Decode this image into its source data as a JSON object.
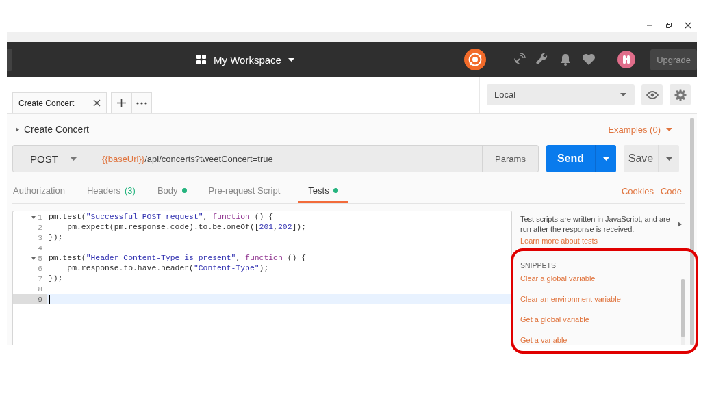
{
  "header": {
    "workspace": "My Workspace",
    "upgrade_button": "Upgrade"
  },
  "tabs": [
    {
      "label": "Create Concert",
      "selected": true
    }
  ],
  "environment": {
    "value": "Local"
  },
  "request": {
    "name": "Create Concert",
    "expanded": false,
    "examples": "Examples (0)",
    "method": "POST",
    "url": {
      "variable": "{{baseUrl}}",
      "path": "/api/concerts?tweetConcert=true"
    },
    "params_button": "Params",
    "send_button": "Send",
    "save_button": "Save"
  },
  "sub_tabs": [
    {
      "label": "Authorization",
      "selected": false,
      "indicator": false
    },
    {
      "label": "Headers",
      "count": "(3)",
      "selected": false,
      "indicator": false
    },
    {
      "label": "Body",
      "selected": false,
      "indicator": true
    },
    {
      "label": "Pre-request Script",
      "selected": false,
      "indicator": false
    },
    {
      "label": "Tests",
      "selected": true,
      "indicator": true
    }
  ],
  "links": [
    "Cookies",
    "Code"
  ],
  "editor": {
    "lines": [
      {
        "number": "1",
        "foldable": true,
        "current": false,
        "tokens": [
          {
            "kind": "plain",
            "text": "pm.test("
          },
          {
            "kind": "string",
            "text": "\"Successful POST request\""
          },
          {
            "kind": "plain",
            "text": ", "
          },
          {
            "kind": "keyword",
            "text": "function"
          },
          {
            "kind": "plain",
            "text": " () {"
          }
        ]
      },
      {
        "number": "2",
        "foldable": false,
        "current": false,
        "tokens": [
          {
            "kind": "plain",
            "text": "    pm.expect(pm.response.code).to.be.oneOf(["
          },
          {
            "kind": "number",
            "text": "201"
          },
          {
            "kind": "plain",
            "text": ","
          },
          {
            "kind": "number",
            "text": "202"
          },
          {
            "kind": "plain",
            "text": "]);"
          }
        ]
      },
      {
        "number": "3",
        "foldable": false,
        "current": false,
        "tokens": [
          {
            "kind": "plain",
            "text": "});"
          }
        ]
      },
      {
        "number": "4",
        "foldable": false,
        "current": false
      },
      {
        "number": "5",
        "foldable": true,
        "current": false,
        "tokens": [
          {
            "kind": "plain",
            "text": "pm.test("
          },
          {
            "kind": "string",
            "text": "\"Header Content-Type is present\""
          },
          {
            "kind": "plain",
            "text": ", "
          },
          {
            "kind": "keyword",
            "text": "function"
          },
          {
            "kind": "plain",
            "text": " () {"
          }
        ]
      },
      {
        "number": "6",
        "foldable": false,
        "current": false,
        "tokens": [
          {
            "kind": "plain",
            "text": "    pm.response.to.have.header("
          },
          {
            "kind": "string",
            "text": "\"Content-Type\""
          },
          {
            "kind": "plain",
            "text": ");"
          }
        ]
      },
      {
        "number": "7",
        "foldable": false,
        "current": false,
        "tokens": [
          {
            "kind": "plain",
            "text": "});"
          }
        ]
      },
      {
        "number": "8",
        "foldable": false,
        "current": false
      },
      {
        "number": "9",
        "foldable": false,
        "current": true
      }
    ]
  },
  "side_panel": {
    "description": "Test scripts are written in JavaScript, and are run after the response is received.",
    "learn_more": "Learn more about tests",
    "snippets_heading": "SNIPPETS",
    "snippets": [
      "Clear a global variable",
      "Clear an environment variable",
      "Get a global variable",
      "Get a variable"
    ]
  }
}
